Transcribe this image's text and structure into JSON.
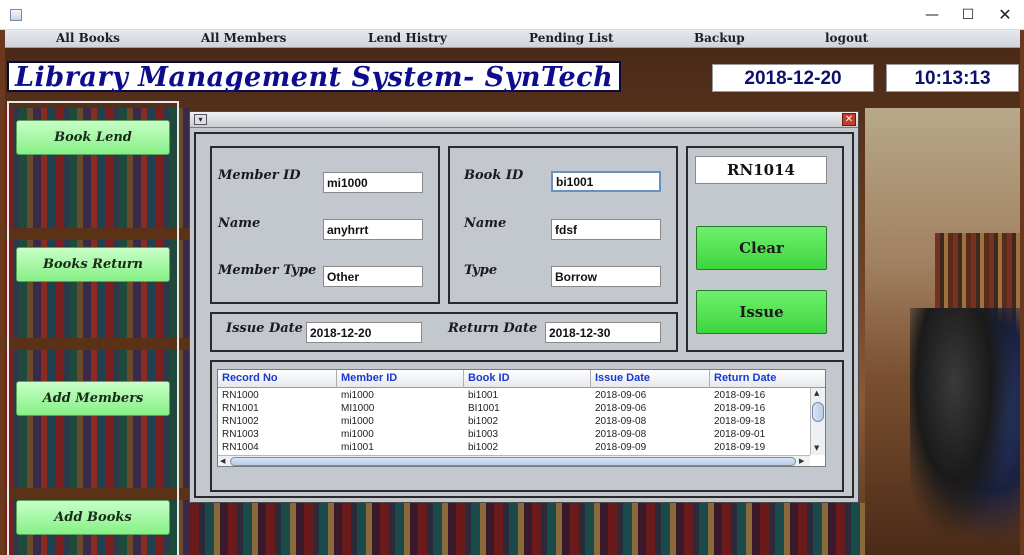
{
  "window": {
    "minimize": "—",
    "maximize": "☐",
    "close": "✕"
  },
  "menu": {
    "items": [
      "All Books",
      "All Members",
      "Lend Histry",
      "Pending List",
      "Backup",
      "logout"
    ]
  },
  "header": {
    "title": "Library Management System- SynTech",
    "date": "2018-12-20",
    "time": "10:13:13"
  },
  "nav": {
    "book_lend": "Book Lend",
    "books_return": "Books Return",
    "add_members": "Add Members",
    "add_books": "Add Books"
  },
  "form": {
    "member_id_label": "Member ID",
    "member_id": "mi1000",
    "member_name_label": "Name",
    "member_name": "anyhrrt",
    "member_type_label": "Member Type",
    "member_type": "Other",
    "book_id_label": "Book ID",
    "book_id": "bi1001",
    "book_name_label": "Name",
    "book_name": "fdsf",
    "book_type_label": "Type",
    "book_type": "Borrow",
    "issue_date_label": "Issue Date",
    "issue_date": "2018-12-20",
    "return_date_label": "Return Date",
    "return_date": "2018-12-30",
    "record_no": "RN1014",
    "clear_label": "Clear",
    "issue_label": "Issue"
  },
  "table": {
    "columns": [
      "Record No",
      "Member ID",
      "Book ID",
      "Issue Date",
      "Return Date"
    ],
    "rows": [
      [
        "RN1000",
        "mi1000",
        "bi1001",
        "2018-09-06",
        "2018-09-16"
      ],
      [
        "RN1001",
        "MI1000",
        "BI1001",
        "2018-09-06",
        "2018-09-16"
      ],
      [
        "RN1002",
        "mi1000",
        "bi1002",
        "2018-09-08",
        "2018-09-18"
      ],
      [
        "RN1003",
        "mi1000",
        "bi1003",
        "2018-09-08",
        "2018-09-01"
      ],
      [
        "RN1004",
        "mi1001",
        "bi1002",
        "2018-09-09",
        "2018-09-19"
      ]
    ]
  },
  "colors": {
    "accent_title": "#0c0c8c",
    "green_button": "#3ed63e",
    "table_header_text": "#1a3ad0"
  }
}
